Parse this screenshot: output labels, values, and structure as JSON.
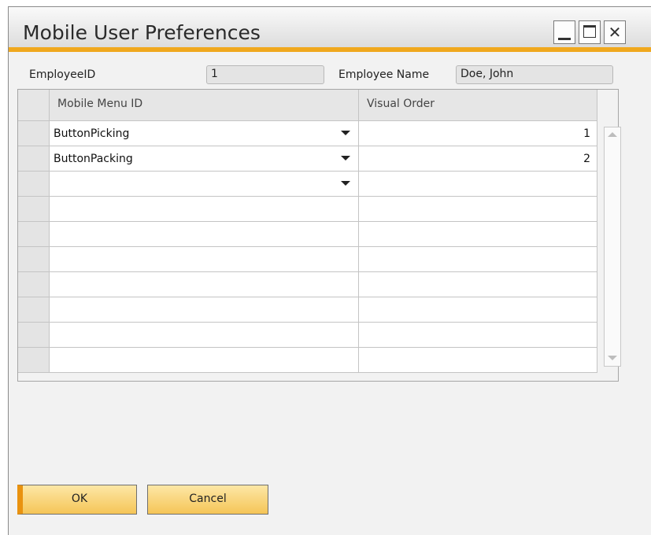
{
  "window": {
    "title": "Mobile User Preferences",
    "controls": {
      "minimize_icon": "minimize-icon",
      "maximize_icon": "maximize-icon",
      "close_icon": "close-icon",
      "close_glyph": "✕"
    }
  },
  "header": {
    "employee_id_label": "EmployeeID",
    "employee_id_value": "1",
    "employee_name_label": "Employee Name",
    "employee_name_value": "Doe, John"
  },
  "grid": {
    "columns": [
      "Mobile Menu ID",
      "Visual Order"
    ],
    "rows": [
      {
        "menu_id": "ButtonPicking",
        "order": "1"
      },
      {
        "menu_id": "ButtonPacking",
        "order": "2"
      },
      {
        "menu_id": "",
        "order": ""
      },
      {
        "menu_id": "",
        "order": ""
      },
      {
        "menu_id": "",
        "order": ""
      },
      {
        "menu_id": "",
        "order": ""
      },
      {
        "menu_id": "",
        "order": ""
      },
      {
        "menu_id": "",
        "order": ""
      },
      {
        "menu_id": "",
        "order": ""
      },
      {
        "menu_id": "",
        "order": ""
      }
    ]
  },
  "buttons": {
    "ok": "OK",
    "cancel": "Cancel"
  },
  "colors": {
    "accent": "#f0a81e",
    "button_fill": "#f8d47a",
    "ok_indicator": "#e9920f"
  }
}
